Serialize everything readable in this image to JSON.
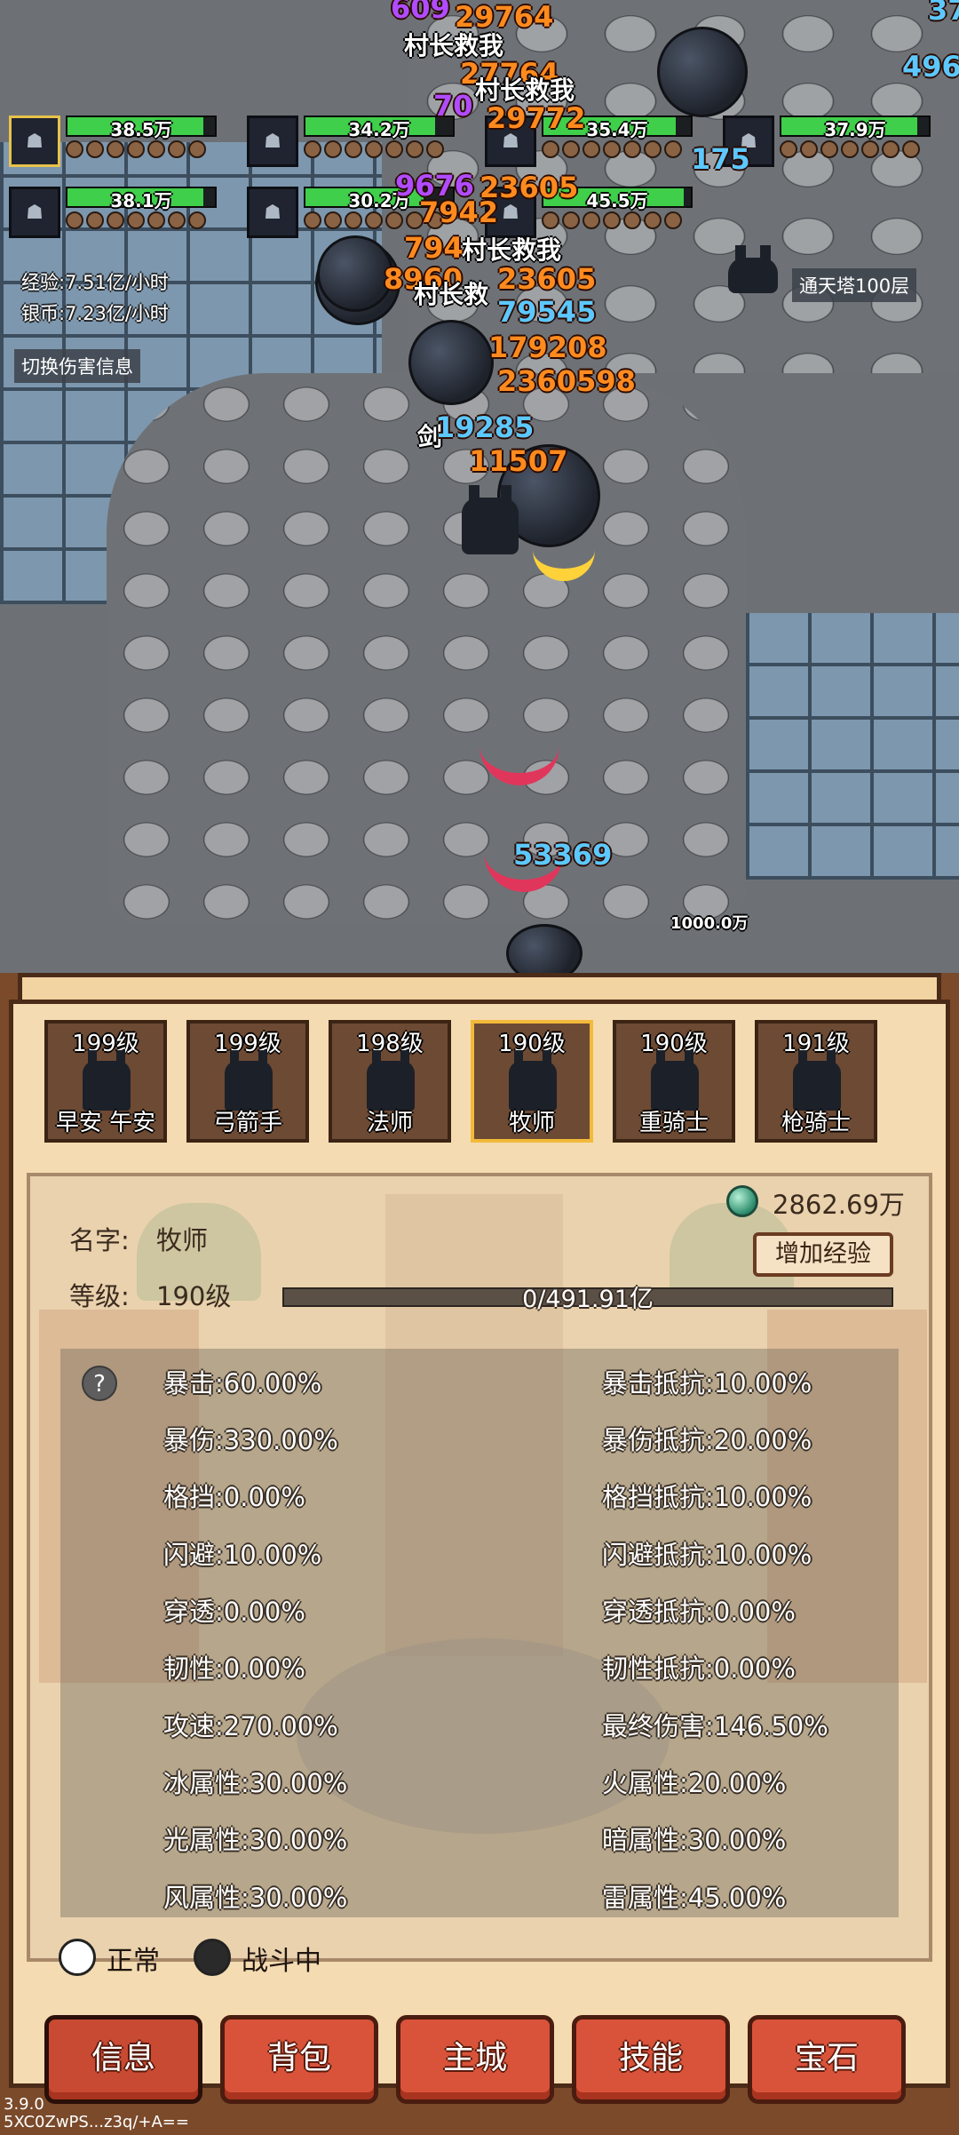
{
  "party": [
    {
      "hp": "38.5万",
      "hp_fill": 0.92,
      "selected": true
    },
    {
      "hp": "34.2万",
      "hp_fill": 0.88,
      "selected": false
    },
    {
      "hp": "35.4万",
      "hp_fill": 0.9,
      "selected": false
    },
    {
      "hp": "37.9万",
      "hp_fill": 0.92,
      "selected": false
    },
    {
      "hp": "38.1万",
      "hp_fill": 0.92,
      "selected": false
    },
    {
      "hp": "30.2万",
      "hp_fill": 0.8,
      "selected": false
    },
    {
      "hp": "45.5万",
      "hp_fill": 0.95,
      "selected": false
    }
  ],
  "rates": {
    "exp": "经验:7.51亿/小时",
    "silver": "银币:7.23亿/小时"
  },
  "toggle_damage_info": "切换伤害信息",
  "stage": "通天塔100层",
  "floating": {
    "dmg": [
      "29764",
      "27764",
      "29772",
      "23605",
      "23605",
      "79545",
      "179208",
      "2360598",
      "19285",
      "11507",
      "53369",
      "1000.0万",
      "9676",
      "7942",
      "794",
      "8960"
    ],
    "shouts": [
      "村长救我",
      "村长救我",
      "村长救我",
      "村长救"
    ],
    "top_right": [
      "37",
      "496",
      "175"
    ],
    "purple": [
      "609",
      "70"
    ],
    "misc": [
      "剑"
    ]
  },
  "heroes": [
    {
      "level": "199级",
      "name": "早安 午安",
      "selected": false
    },
    {
      "level": "199级",
      "name": "弓箭手",
      "selected": false
    },
    {
      "level": "198级",
      "name": "法师",
      "selected": false
    },
    {
      "level": "190级",
      "name": "牧师",
      "selected": true
    },
    {
      "level": "190级",
      "name": "重骑士",
      "selected": false
    },
    {
      "level": "191级",
      "name": "枪骑士",
      "selected": false
    }
  ],
  "details": {
    "currency": "2862.69万",
    "name_label": "名字:",
    "name_value": "牧师",
    "level_label": "等级:",
    "level_value": "190级",
    "add_exp": "增加经验",
    "exp_progress": "0/491.91亿",
    "exp_fill": 0,
    "help": "?"
  },
  "stats_left": [
    "暴击:60.00%",
    "暴伤:330.00%",
    "格挡:0.00%",
    "闪避:10.00%",
    "穿透:0.00%",
    "韧性:0.00%",
    "攻速:270.00%",
    "冰属性:30.00%",
    "光属性:30.00%",
    "风属性:30.00%"
  ],
  "stats_right": [
    "暴击抵抗:10.00%",
    "暴伤抵抗:20.00%",
    "格挡抵抗:10.00%",
    "闪避抵抗:10.00%",
    "穿透抵抗:0.00%",
    "韧性抵抗:0.00%",
    "最终伤害:146.50%",
    "火属性:20.00%",
    "暗属性:30.00%",
    "雷属性:45.00%"
  ],
  "status": {
    "normal": "正常",
    "in_battle": "战斗中",
    "current": "in_battle"
  },
  "nav": [
    "信息",
    "背包",
    "主城",
    "技能",
    "宝石"
  ],
  "nav_active": 0,
  "version": "3.9.0",
  "build_id": "5XC0ZwPS...z3q/+A=="
}
